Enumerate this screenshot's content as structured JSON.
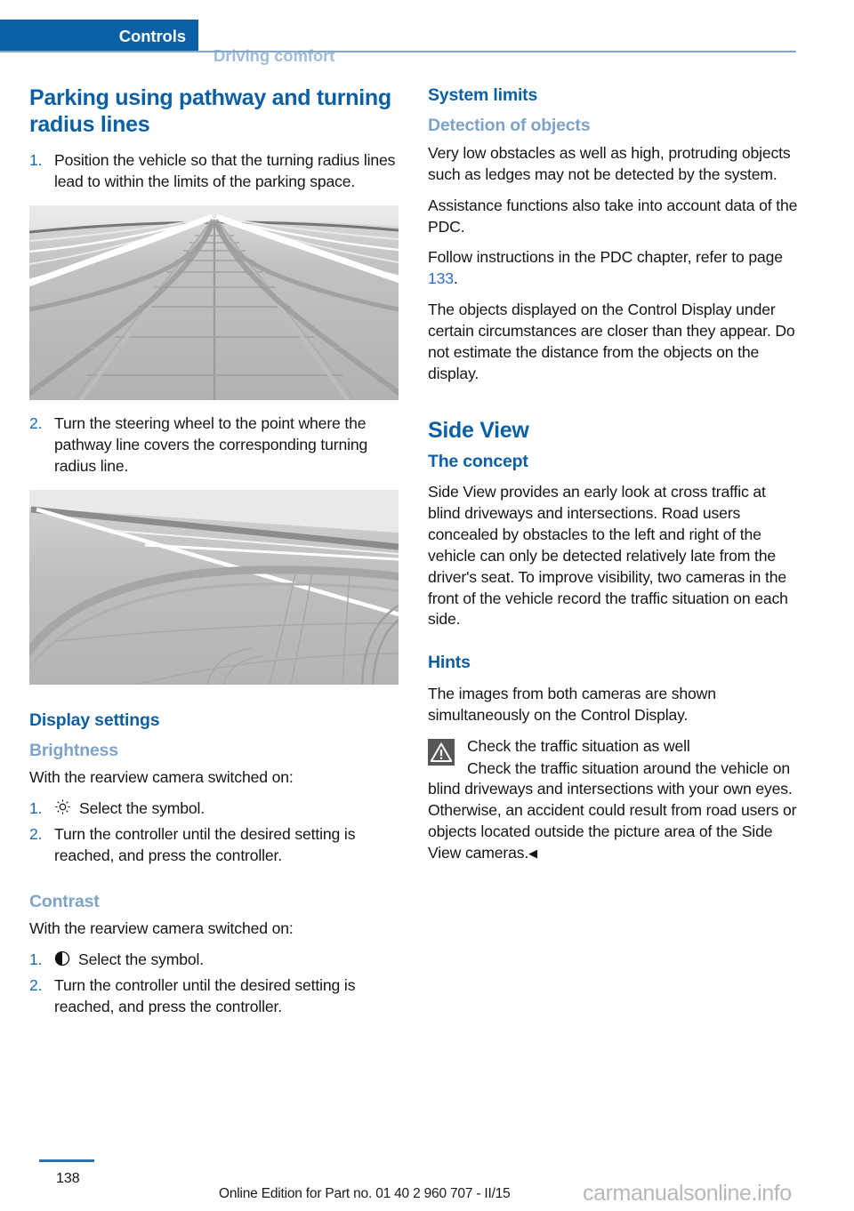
{
  "header": {
    "active_tab": "Controls",
    "inactive_tab": "Driving comfort"
  },
  "left_column": {
    "heading": "Parking using pathway and turning radius lines",
    "steps_1": [
      {
        "num": "1.",
        "text": "Position the vehicle so that the turning radius lines lead to within the limits of the parking space."
      }
    ],
    "figure_1_name": "rearview-camera-pathway-lines",
    "steps_2": [
      {
        "num": "2.",
        "text": "Turn the steering wheel to the point where the pathway line covers the corresponding turning radius line."
      }
    ],
    "figure_2_name": "rearview-camera-turning-radius-lines",
    "display_settings_heading": "Display settings",
    "brightness": {
      "heading": "Brightness",
      "intro": "With the rearview camera switched on:",
      "steps": [
        {
          "num": "1.",
          "icon": "sun-icon",
          "text": "Select the symbol."
        },
        {
          "num": "2.",
          "icon": "",
          "text": "Turn the controller until the desired setting is reached, and press the controller."
        }
      ]
    },
    "contrast": {
      "heading": "Contrast",
      "intro": "With the rearview camera switched on:",
      "steps": [
        {
          "num": "1.",
          "icon": "contrast-icon",
          "text": "Select the symbol."
        },
        {
          "num": "2.",
          "icon": "",
          "text": "Turn the controller until the desired setting is reached, and press the controller."
        }
      ]
    }
  },
  "right_column": {
    "system_limits_heading": "System limits",
    "detection_heading": "Detection of objects",
    "detection_p1": "Very low obstacles as well as high, protruding objects such as ledges may not be detected by the system.",
    "detection_p2": "Assistance functions also take into account data of the PDC.",
    "detection_p3_pre": "Follow instructions in the PDC chapter, refer to page ",
    "detection_p3_ref": "133",
    "detection_p3_post": ".",
    "detection_p4": "The objects displayed on the Control Display under certain circumstances are closer than they appear. Do not estimate the distance from the objects on the display.",
    "side_view_heading": "Side View",
    "concept_heading": "The concept",
    "concept_p1": "Side View provides an early look at cross traffic at blind driveways and intersections. Road users concealed by obstacles to the left and right of the vehicle can only be detected relatively late from the driver's seat. To improve visibility, two cameras in the front of the vehicle record the traffic situation on each side.",
    "hints_heading": "Hints",
    "hints_p1": "The images from both cameras are shown simultaneously on the Control Display.",
    "warning": {
      "icon": "warning-triangle-icon",
      "title": "Check the traffic situation as well",
      "body": "Check the traffic situation around the vehicle on blind driveways and intersections with your own eyes. Otherwise, an accident could result from road users or objects located outside the picture area of the Side View cameras.",
      "endmark": "◀"
    }
  },
  "footer": {
    "page_number": "138",
    "edition": "Online Edition for Part no. 01 40 2 960 707 - II/15",
    "watermark": "carmanualsonline.info"
  },
  "colors": {
    "brand_blue": "#0b5fa5",
    "light_blue_heading": "#7fa3c8",
    "link_blue": "#2d6fd6",
    "list_num_blue": "#1a6bb5",
    "warning_gray": "#575757"
  }
}
